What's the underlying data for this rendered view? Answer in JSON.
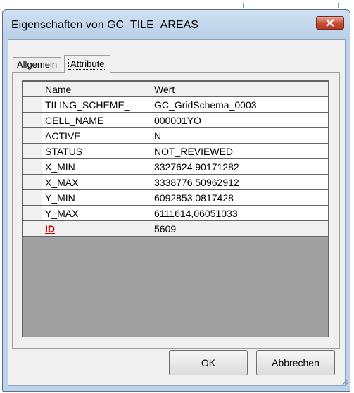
{
  "window": {
    "title": "Eigenschaften von GC_TILE_AREAS"
  },
  "tabs": [
    {
      "label": "Allgemein",
      "active": false
    },
    {
      "label": "Attribute",
      "active": true
    }
  ],
  "grid": {
    "columns": [
      "Name",
      "Wert"
    ],
    "rows": [
      {
        "name": "TILING_SCHEME_",
        "value": "GC_GridSchema_0003"
      },
      {
        "name": "CELL_NAME",
        "value": "000001YO"
      },
      {
        "name": "ACTIVE",
        "value": "N"
      },
      {
        "name": "STATUS",
        "value": "NOT_REVIEWED"
      },
      {
        "name": "X_MIN",
        "value": "3327624,90171282"
      },
      {
        "name": "X_MAX",
        "value": "3338776,50962912"
      },
      {
        "name": "Y_MIN",
        "value": "6092853,0817428"
      },
      {
        "name": "Y_MAX",
        "value": "6111614,06051033"
      },
      {
        "name": "ID",
        "value": "5609",
        "is_key": true
      }
    ]
  },
  "buttons": {
    "ok": "OK",
    "cancel": "Abbrechen"
  },
  "colors": {
    "title_bar": "#bcd3ea",
    "close_button": "#c94a35",
    "key_field": "#d40000"
  }
}
